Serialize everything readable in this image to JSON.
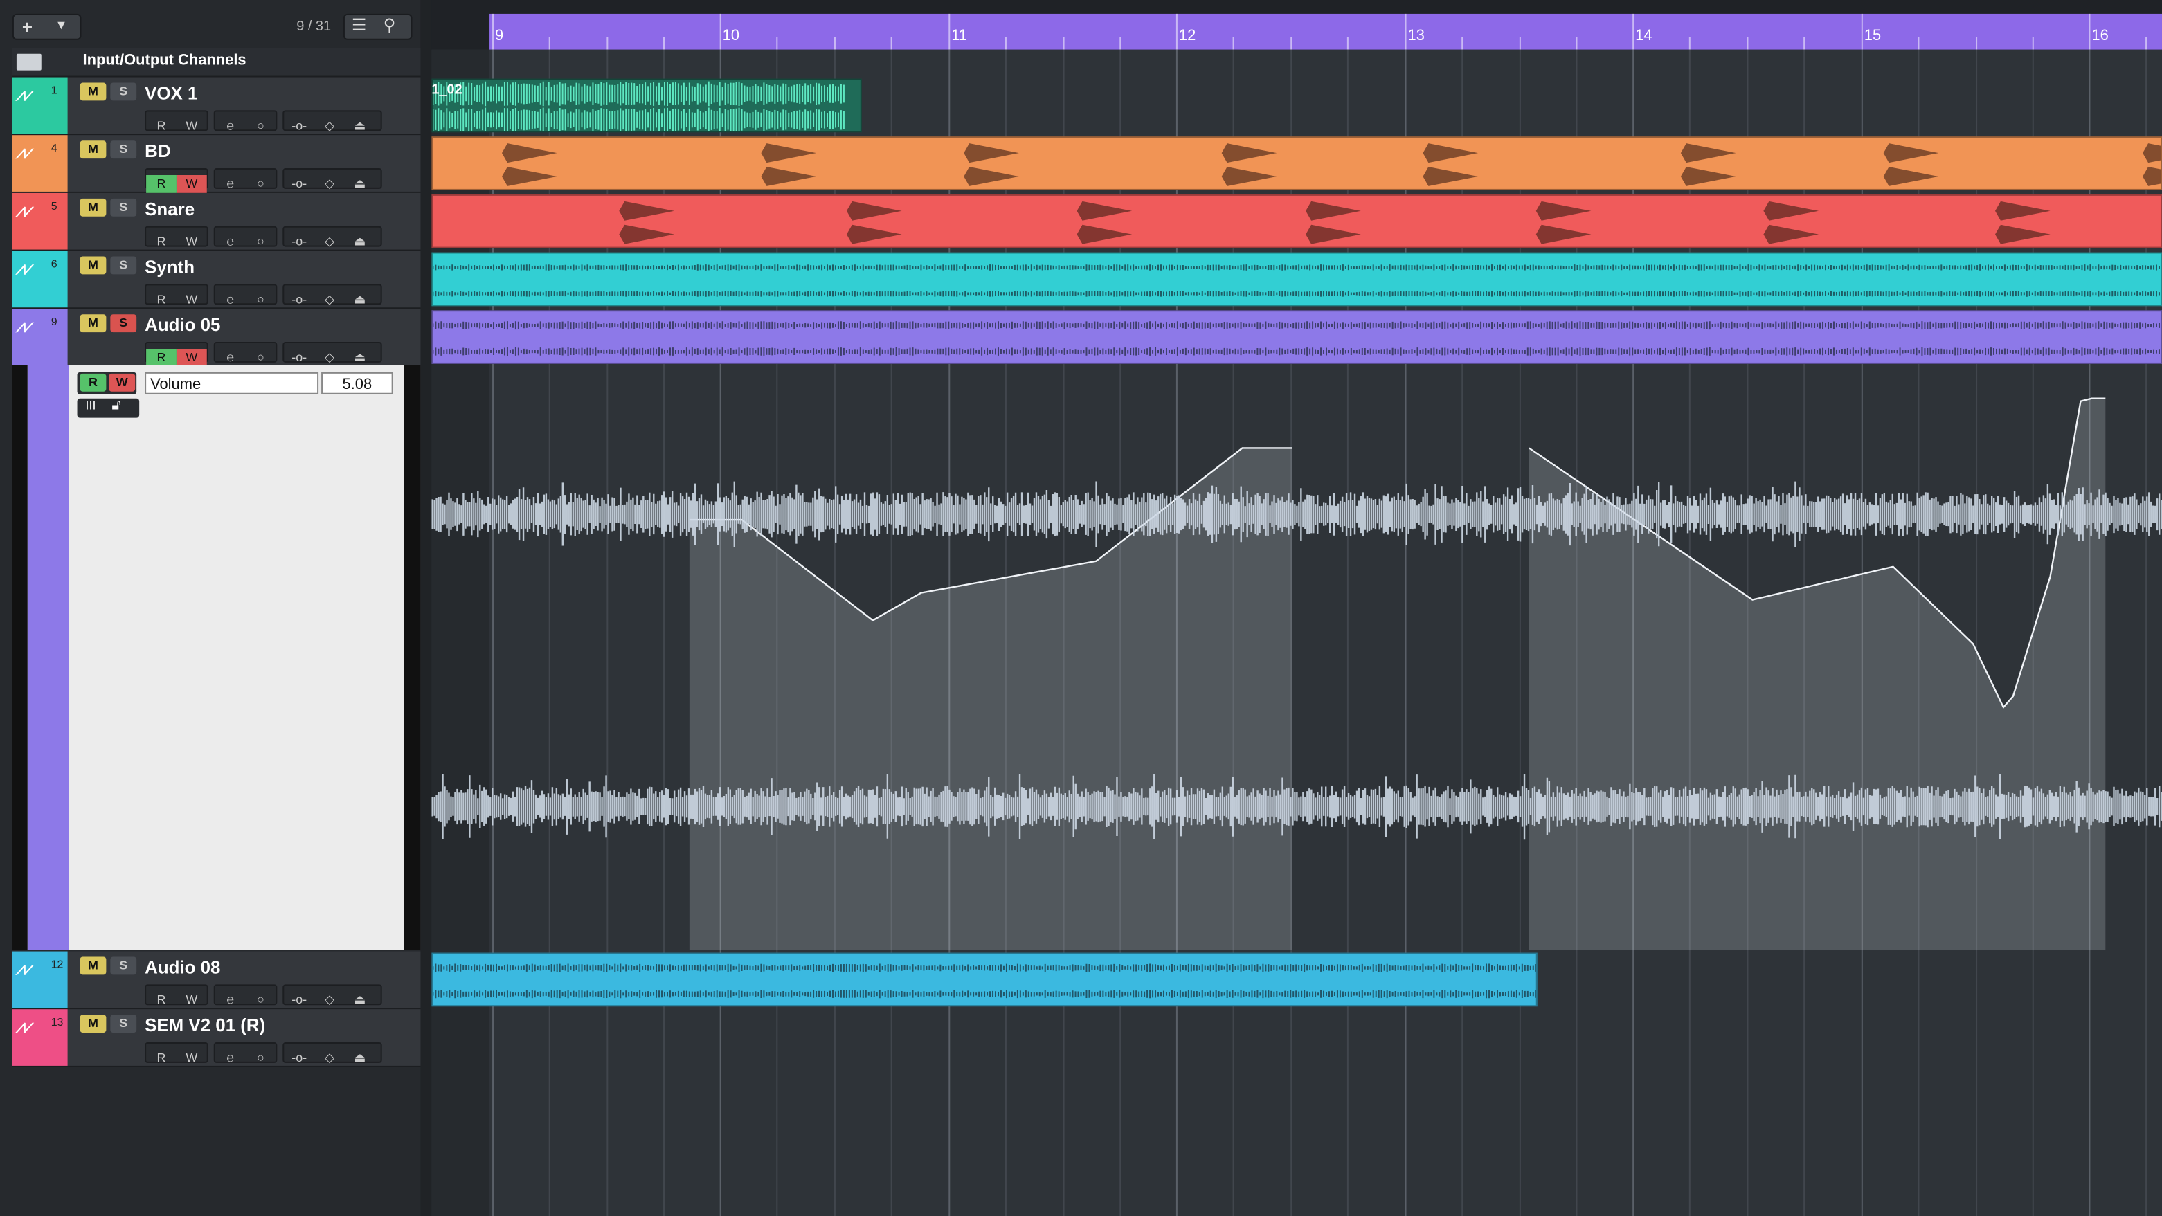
{
  "toolbar": {
    "add_icon": "plus-icon",
    "dropdown_icon": "chevron-down-icon",
    "track_counter": "9 / 31",
    "list_icon": "list-icon",
    "search_icon": "search-icon"
  },
  "folder": {
    "icon": "folder-icon",
    "label": "Input/Output Channels"
  },
  "tracks": [
    {
      "id": "vox1",
      "number": "1",
      "name": "VOX 1",
      "color": "#2cc9a0",
      "mute": "M",
      "solo": "S",
      "read": "R",
      "write": "W"
    },
    {
      "id": "bd",
      "number": "4",
      "name": "BD",
      "color": "#f19455",
      "mute": "M",
      "solo": "S",
      "read": "R",
      "write": "W"
    },
    {
      "id": "snare",
      "number": "5",
      "name": "Snare",
      "color": "#f05b5b",
      "mute": "M",
      "solo": "S",
      "read": "R",
      "write": "W"
    },
    {
      "id": "synth",
      "number": "6",
      "name": "Synth",
      "color": "#32cfd3",
      "mute": "M",
      "solo": "S",
      "read": "R",
      "write": "W"
    },
    {
      "id": "audio05",
      "number": "9",
      "name": "Audio 05",
      "color": "#8d79e8",
      "mute": "M",
      "solo": "S",
      "read": "R",
      "write": "W"
    },
    {
      "id": "audio08",
      "number": "12",
      "name": "Audio 08",
      "color": "#3bb9e0",
      "mute": "M",
      "solo": "S",
      "read": "R",
      "write": "W"
    },
    {
      "id": "sem",
      "number": "13",
      "name": "SEM V2 01 (R)",
      "color": "#ee4f86",
      "mute": "M",
      "solo": "S",
      "read": "R",
      "write": "W"
    }
  ],
  "automation": {
    "read": "R",
    "write": "W",
    "parameter": "Volume",
    "value": "5.08"
  },
  "ruler": {
    "bars": [
      "9",
      "10",
      "11",
      "12",
      "13",
      "14",
      "15",
      "16"
    ]
  },
  "clips": {
    "vox1_clip_label": "1_02"
  },
  "colors": {
    "vox1": "#2cc9a0",
    "bd": "#f19455",
    "snare": "#f05b5b",
    "synth": "#32cfd3",
    "audio05": "#8d79e8",
    "audio08": "#3bb9e0",
    "sem": "#ee4f86",
    "ruler": "#8d69e8"
  }
}
